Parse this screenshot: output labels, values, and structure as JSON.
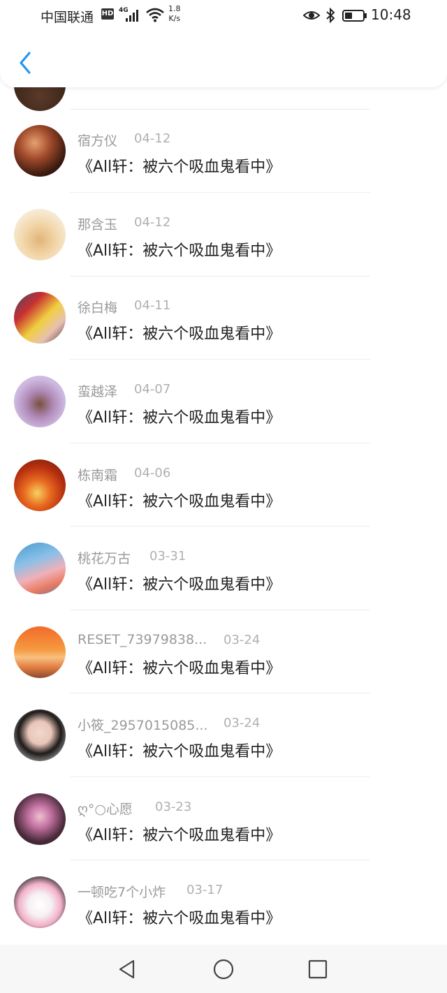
{
  "status_bar": {
    "carrier": "中国联通",
    "hd_badge": "HD",
    "network": "4G",
    "speed_value": "1.8",
    "speed_unit": "K/s",
    "time": "10:48"
  },
  "header": {
    "back_icon": "chevron-left-icon",
    "accent_color": "#2196f3"
  },
  "list": {
    "items": [
      {
        "name": "宿方仪",
        "date": "04-12",
        "message": "《All轩：被六个吸血鬼看中》",
        "avatar": "avatar-dark-anime"
      },
      {
        "name": "那含玉",
        "date": "04-12",
        "message": "《All轩：被六个吸血鬼看中》",
        "avatar": "avatar-hamster"
      },
      {
        "name": "徐白梅",
        "date": "04-11",
        "message": "《All轩：被六个吸血鬼看中》",
        "avatar": "avatar-kids-photo"
      },
      {
        "name": "蛮越泽",
        "date": "04-07",
        "message": "《All轩：被六个吸血鬼看中》",
        "avatar": "avatar-witch-girl"
      },
      {
        "name": "栋南霜",
        "date": "04-06",
        "message": "《All轩：被六个吸血鬼看中》",
        "avatar": "avatar-autumn-trees"
      },
      {
        "name": "桃花万古",
        "date": "03-31",
        "message": "《All轩：被六个吸血鬼看中》",
        "avatar": "avatar-sky-clouds"
      },
      {
        "name": "RESET_73979838...",
        "date": "03-24",
        "message": "《All轩：被六个吸血鬼看中》",
        "avatar": "avatar-sunset-girl"
      },
      {
        "name": "小筱_2957015085...",
        "date": "03-24",
        "message": "《All轩：被六个吸血鬼看中》",
        "avatar": "avatar-girl-portrait"
      },
      {
        "name": "ღ°○心愿",
        "date": "03-23",
        "message": "《All轩：被六个吸血鬼看中》",
        "avatar": "avatar-party-girl"
      },
      {
        "name": "一顿吃7个小炸",
        "date": "03-17",
        "message": "《All轩：被六个吸血鬼看中》",
        "avatar": "avatar-kuromi"
      }
    ]
  },
  "nav_bar": {
    "back": "triangle-back-icon",
    "home": "circle-home-icon",
    "recent": "square-recent-icon"
  }
}
